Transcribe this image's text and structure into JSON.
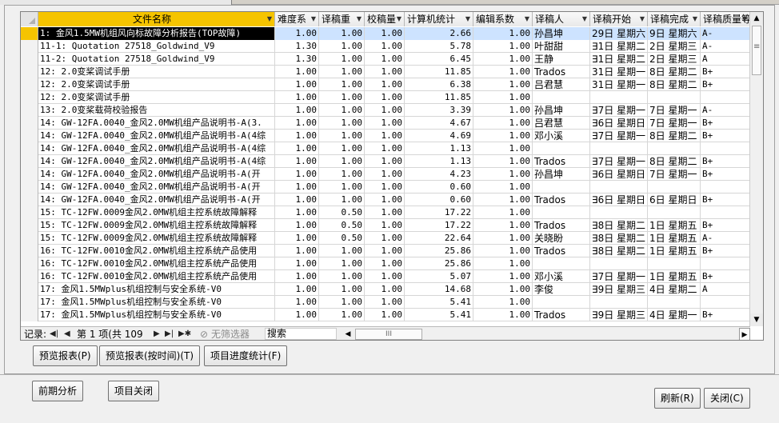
{
  "grid": {
    "columns": [
      {
        "key": "name",
        "label": "文件名称"
      },
      {
        "key": "difficulty",
        "label": "难度系"
      },
      {
        "key": "repeat",
        "label": "译稿重"
      },
      {
        "key": "review",
        "label": "校稿量"
      },
      {
        "key": "computer_stats",
        "label": "计算机统计"
      },
      {
        "key": "edit_coef",
        "label": "编辑系数"
      },
      {
        "key": "translator",
        "label": "译稿人"
      },
      {
        "key": "start",
        "label": "译稿开始"
      },
      {
        "key": "finish",
        "label": "译稿完成"
      },
      {
        "key": "quality",
        "label": "译稿质量等级"
      }
    ],
    "rows": [
      {
        "name": "1: 金风1.5MW机组风向标故障分析报告(TOP故障)",
        "difficulty": "1.00",
        "repeat": "1.00",
        "review": "1.00",
        "computer_stats": "2.66",
        "edit_coef": "1.00",
        "translator": "孙昌坤",
        "start": "29日 星期六",
        "finish": "9日 星期六",
        "quality": "A-"
      },
      {
        "name": "11-1: Quotation 27518_Goldwind_V9",
        "difficulty": "1.30",
        "repeat": "1.00",
        "review": "1.00",
        "computer_stats": "5.78",
        "edit_coef": "1.00",
        "translator": "叶甜甜",
        "start": "∃1日 星期二",
        "finish": "2日 星期三",
        "quality": "A-"
      },
      {
        "name": "11-2: Quotation 27518_Goldwind_V9",
        "difficulty": "1.30",
        "repeat": "1.00",
        "review": "1.00",
        "computer_stats": "6.45",
        "edit_coef": "1.00",
        "translator": "王静",
        "start": "∃1日 星期二",
        "finish": "2日 星期三",
        "quality": "A"
      },
      {
        "name": "12: 2.0变桨调试手册",
        "difficulty": "1.00",
        "repeat": "1.00",
        "review": "1.00",
        "computer_stats": "11.85",
        "edit_coef": "1.00",
        "translator": "Trados",
        "start": "31日 星期一",
        "finish": "8日 星期二",
        "quality": "B+"
      },
      {
        "name": "12: 2.0变桨调试手册",
        "difficulty": "1.00",
        "repeat": "1.00",
        "review": "1.00",
        "computer_stats": "6.38",
        "edit_coef": "1.00",
        "translator": "吕君慧",
        "start": "31日 星期一",
        "finish": "8日 星期二",
        "quality": "B+"
      },
      {
        "name": "12: 2.0变桨调试手册",
        "difficulty": "1.00",
        "repeat": "1.00",
        "review": "1.00",
        "computer_stats": "11.85",
        "edit_coef": "1.00",
        "translator": "",
        "start": "",
        "finish": "",
        "quality": ""
      },
      {
        "name": "13: 2.0变桨载荷校验报告",
        "difficulty": "1.00",
        "repeat": "1.00",
        "review": "1.00",
        "computer_stats": "3.39",
        "edit_coef": "1.00",
        "translator": "孙昌坤",
        "start": "∃7日 星期一",
        "finish": "7日 星期一",
        "quality": "A-"
      },
      {
        "name": "14: GW-12FA.0040_金风2.0MW机组产品说明书-A(3.",
        "difficulty": "1.00",
        "repeat": "1.00",
        "review": "1.00",
        "computer_stats": "4.67",
        "edit_coef": "1.00",
        "translator": "吕君慧",
        "start": "∃6日 星期日",
        "finish": "7日 星期一",
        "quality": "B+"
      },
      {
        "name": "14: GW-12FA.0040_金风2.0MW机组产品说明书-A(4综",
        "difficulty": "1.00",
        "repeat": "1.00",
        "review": "1.00",
        "computer_stats": "4.69",
        "edit_coef": "1.00",
        "translator": "邓小溪",
        "start": "∃7日 星期一",
        "finish": "8日 星期二",
        "quality": "B+"
      },
      {
        "name": "14: GW-12FA.0040_金风2.0MW机组产品说明书-A(4综",
        "difficulty": "1.00",
        "repeat": "1.00",
        "review": "1.00",
        "computer_stats": "1.13",
        "edit_coef": "1.00",
        "translator": "",
        "start": "",
        "finish": "",
        "quality": ""
      },
      {
        "name": "14: GW-12FA.0040_金风2.0MW机组产品说明书-A(4综",
        "difficulty": "1.00",
        "repeat": "1.00",
        "review": "1.00",
        "computer_stats": "1.13",
        "edit_coef": "1.00",
        "translator": "Trados",
        "start": "∃7日 星期一",
        "finish": "8日 星期二",
        "quality": "B+"
      },
      {
        "name": "14: GW-12FA.0040_金风2.0MW机组产品说明书-A(开",
        "difficulty": "1.00",
        "repeat": "1.00",
        "review": "1.00",
        "computer_stats": "4.23",
        "edit_coef": "1.00",
        "translator": "孙昌坤",
        "start": "∃6日 星期日",
        "finish": "7日 星期一",
        "quality": "B+"
      },
      {
        "name": "14: GW-12FA.0040_金风2.0MW机组产品说明书-A(开",
        "difficulty": "1.00",
        "repeat": "1.00",
        "review": "1.00",
        "computer_stats": "0.60",
        "edit_coef": "1.00",
        "translator": "",
        "start": "",
        "finish": "",
        "quality": ""
      },
      {
        "name": "14: GW-12FA.0040_金风2.0MW机组产品说明书-A(开",
        "difficulty": "1.00",
        "repeat": "1.00",
        "review": "1.00",
        "computer_stats": "0.60",
        "edit_coef": "1.00",
        "translator": "Trados",
        "start": "∃6日 星期日",
        "finish": "6日 星期日",
        "quality": "B+"
      },
      {
        "name": "15: TC-12FW.0009金风2.0MW机组主控系统故障解释",
        "difficulty": "1.00",
        "repeat": "0.50",
        "review": "1.00",
        "computer_stats": "17.22",
        "edit_coef": "1.00",
        "translator": "",
        "start": "",
        "finish": "",
        "quality": ""
      },
      {
        "name": "15: TC-12FW.0009金风2.0MW机组主控系统故障解释",
        "difficulty": "1.00",
        "repeat": "0.50",
        "review": "1.00",
        "computer_stats": "17.22",
        "edit_coef": "1.00",
        "translator": "Trados",
        "start": "∃8日 星期二",
        "finish": "1日 星期五",
        "quality": "B+"
      },
      {
        "name": "15: TC-12FW.0009金风2.0MW机组主控系统故障解释",
        "difficulty": "1.00",
        "repeat": "0.50",
        "review": "1.00",
        "computer_stats": "22.64",
        "edit_coef": "1.00",
        "translator": "关晓盼",
        "start": "∃8日 星期二",
        "finish": "1日 星期五",
        "quality": "A-"
      },
      {
        "name": "16: TC-12FW.0010金风2.0MW机组主控系统产品使用",
        "difficulty": "1.00",
        "repeat": "1.00",
        "review": "1.00",
        "computer_stats": "25.86",
        "edit_coef": "1.00",
        "translator": "Trados",
        "start": "∃8日 星期二",
        "finish": "1日 星期五",
        "quality": "B+"
      },
      {
        "name": "16: TC-12FW.0010金风2.0MW机组主控系统产品使用",
        "difficulty": "1.00",
        "repeat": "1.00",
        "review": "1.00",
        "computer_stats": "25.86",
        "edit_coef": "1.00",
        "translator": "",
        "start": "",
        "finish": "",
        "quality": ""
      },
      {
        "name": "16: TC-12FW.0010金风2.0MW机组主控系统产品使用",
        "difficulty": "1.00",
        "repeat": "1.00",
        "review": "1.00",
        "computer_stats": "5.07",
        "edit_coef": "1.00",
        "translator": "邓小溪",
        "start": "∃7日 星期一",
        "finish": "1日 星期五",
        "quality": "B+"
      },
      {
        "name": "17: 金风1.5MWplus机组控制与安全系统-V0",
        "difficulty": "1.00",
        "repeat": "1.00",
        "review": "1.00",
        "computer_stats": "14.68",
        "edit_coef": "1.00",
        "translator": "李俊",
        "start": "∃9日 星期三",
        "finish": "4日 星期二",
        "quality": "A"
      },
      {
        "name": "17: 金风1.5MWplus机组控制与安全系统-V0",
        "difficulty": "1.00",
        "repeat": "1.00",
        "review": "1.00",
        "computer_stats": "5.41",
        "edit_coef": "1.00",
        "translator": "",
        "start": "",
        "finish": "",
        "quality": ""
      },
      {
        "name": "17: 金风1.5MWplus机组控制与安全系统-V0",
        "difficulty": "1.00",
        "repeat": "1.00",
        "review": "1.00",
        "computer_stats": "5.41",
        "edit_coef": "1.00",
        "translator": "Trados",
        "start": "∃9日 星期三",
        "finish": "4日 星期一",
        "quality": "B+"
      }
    ]
  },
  "navigator": {
    "record_label": "记录:",
    "position": "第 1 项(共 109",
    "no_filter": "无筛选器",
    "search": "搜索"
  },
  "buttons": {
    "preview_report": "预览报表(P)",
    "preview_by_time": "预览报表(按时间)(T)",
    "project_progress": "项目进度统计(F)",
    "pre_analysis": "前期分析",
    "project_close": "项目关闭",
    "refresh": "刷新(R)",
    "close": "关闭(C)"
  }
}
